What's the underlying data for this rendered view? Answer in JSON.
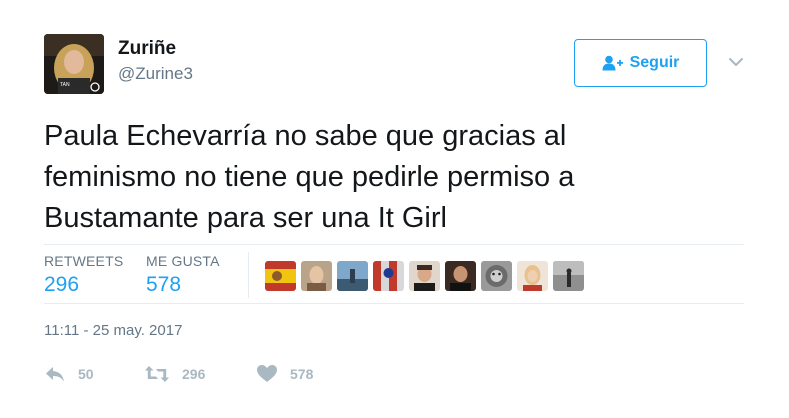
{
  "user": {
    "display_name": "Zuriñe",
    "handle": "@Zurine3",
    "avatar_icon": "profile-photo"
  },
  "follow_button": {
    "label": "Seguir",
    "icon": "person-plus-icon",
    "color": "#1da1f2"
  },
  "menu": {
    "icon": "chevron-down-icon"
  },
  "tweet": {
    "lines": [
      "Paula Echevarría no sabe que gracias al",
      "feminismo no tiene que pedirle permiso a",
      "Bustamante para ser una It Girl"
    ]
  },
  "stats": {
    "retweets_label": "RETWEETS",
    "retweets_value": "296",
    "likes_label": "ME GUSTA",
    "likes_value": "578"
  },
  "likers": [
    "avatar-1",
    "avatar-2",
    "avatar-3",
    "avatar-4",
    "avatar-5",
    "avatar-6",
    "avatar-7",
    "avatar-8",
    "avatar-9",
    "avatar-10"
  ],
  "timestamp": "11:11 - 25 may. 2017",
  "actions": {
    "reply_count": "50",
    "retweet_count": "296",
    "like_count": "578"
  },
  "colors": {
    "accent": "#1da1f2",
    "muted": "#657786",
    "action_gray": "#aab8c2"
  }
}
